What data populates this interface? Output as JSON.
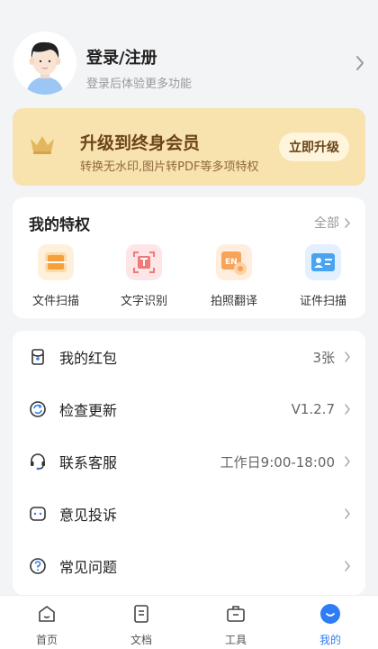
{
  "profile": {
    "title": "登录/注册",
    "subtitle": "登录后体验更多功能"
  },
  "vip": {
    "title": "升级到终身会员",
    "subtitle": "转换无水印,图片转PDF等多项特权",
    "button": "立即升级",
    "color": "#f8e2ae"
  },
  "privileges": {
    "title": "我的特权",
    "all": "全部",
    "items": [
      {
        "label": "文件扫描",
        "icon": "file-scan-icon"
      },
      {
        "label": "文字识别",
        "icon": "text-ocr-icon"
      },
      {
        "label": "拍照翻译",
        "icon": "photo-translate-icon"
      },
      {
        "label": "证件扫描",
        "icon": "id-scan-icon"
      }
    ]
  },
  "menu": {
    "items": [
      {
        "label": "我的红包",
        "value": "3张",
        "icon": "red-packet-icon"
      },
      {
        "label": "检查更新",
        "value": "V1.2.7",
        "icon": "refresh-icon"
      },
      {
        "label": "联系客服",
        "value": "工作日9:00-18:00",
        "icon": "headset-icon"
      },
      {
        "label": "意见投诉",
        "value": "",
        "icon": "feedback-icon"
      },
      {
        "label": "常见问题",
        "value": "",
        "icon": "help-icon"
      }
    ]
  },
  "tabs": [
    {
      "label": "首页",
      "icon": "home-icon"
    },
    {
      "label": "文档",
      "icon": "document-icon"
    },
    {
      "label": "工具",
      "icon": "toolbox-icon"
    },
    {
      "label": "我的",
      "icon": "profile-icon",
      "active": true
    }
  ],
  "colors": {
    "accent": "#2f7cf6",
    "vip_text": "#6b4417"
  }
}
